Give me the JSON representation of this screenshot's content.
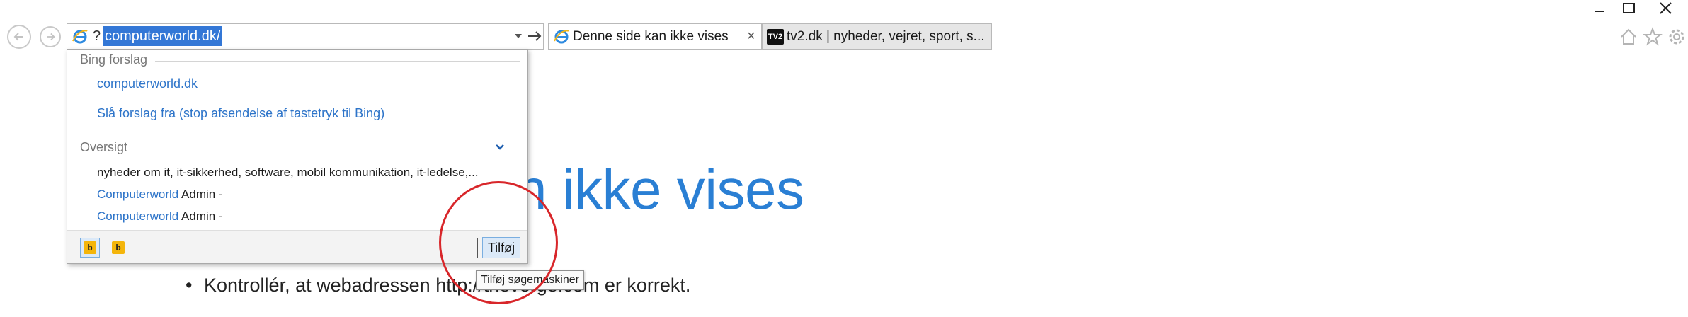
{
  "window": {
    "controls": [
      "minimize-icon",
      "maximize-icon",
      "close-icon"
    ]
  },
  "toolbar": {
    "back_icon": "back-arrow-icon",
    "forward_icon": "forward-arrow-icon",
    "right_icons": [
      "home-icon",
      "favorites-star-icon",
      "settings-gear-icon"
    ]
  },
  "address_bar": {
    "prefix": "?",
    "url": "computerworld.dk/",
    "favicon": "ie-logo-icon"
  },
  "tabs": [
    {
      "title": "Denne side kan ikke vises",
      "close": "×",
      "active": true
    },
    {
      "title": "tv2.dk | nyheder, vejret, sport, s...",
      "favicon_text": "TV2",
      "active": false
    }
  ],
  "page": {
    "heading": "n ikke vises",
    "bullet": "•",
    "bullet_text": "Kontrollér, at webadressen http://theverge.com er korrekt."
  },
  "dropdown": {
    "bing_header": "Bing forslag",
    "bing_suggestions": [
      "computerworld.dk",
      "Slå forslag fra (stop afsendelse af tastetryk til Bing)"
    ],
    "overview_header": "Oversigt",
    "history": [
      {
        "link": "",
        "text": "nyheder om it, it-sikkerhed, software, mobil kommunikation, it-ledelse,..."
      },
      {
        "link": "Computerworld",
        "text": " Admin -"
      },
      {
        "link": "Computerworld",
        "text": " Admin -"
      }
    ],
    "add_button": "Tilføj",
    "provider_icons": [
      "bing-provider-icon",
      "bing-provider-icon"
    ]
  },
  "tooltip": {
    "text": "Tilføj søgemaskiner"
  },
  "colors": {
    "accent": "#2a7fd4",
    "link": "#2d74c9",
    "selection": "#3377d6",
    "annotation": "#d8262a"
  }
}
